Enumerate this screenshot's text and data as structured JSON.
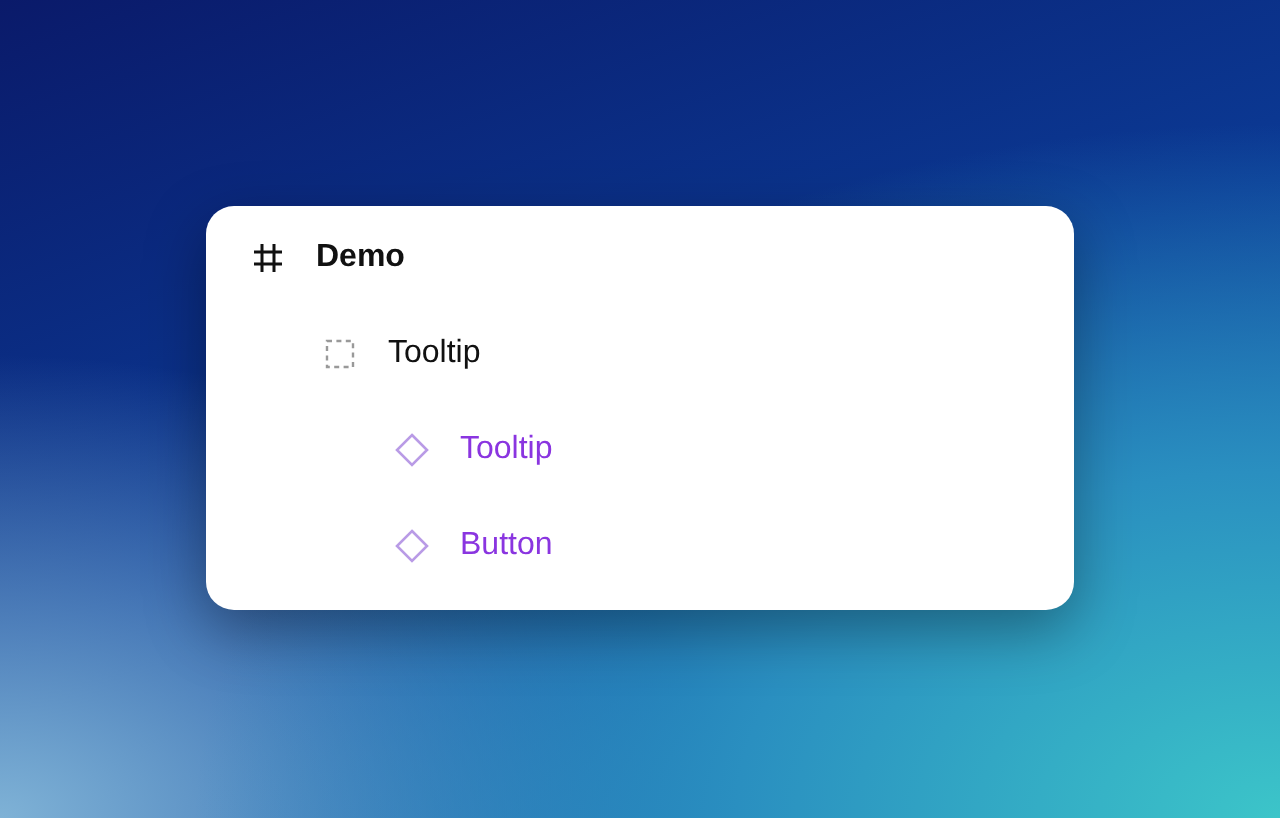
{
  "layers": [
    {
      "kind": "frame",
      "label": "Demo",
      "children": [
        {
          "kind": "group",
          "label": "Tooltip",
          "children": [
            {
              "kind": "instance",
              "label": "Tooltip"
            },
            {
              "kind": "instance",
              "label": "Button"
            }
          ]
        }
      ]
    }
  ]
}
